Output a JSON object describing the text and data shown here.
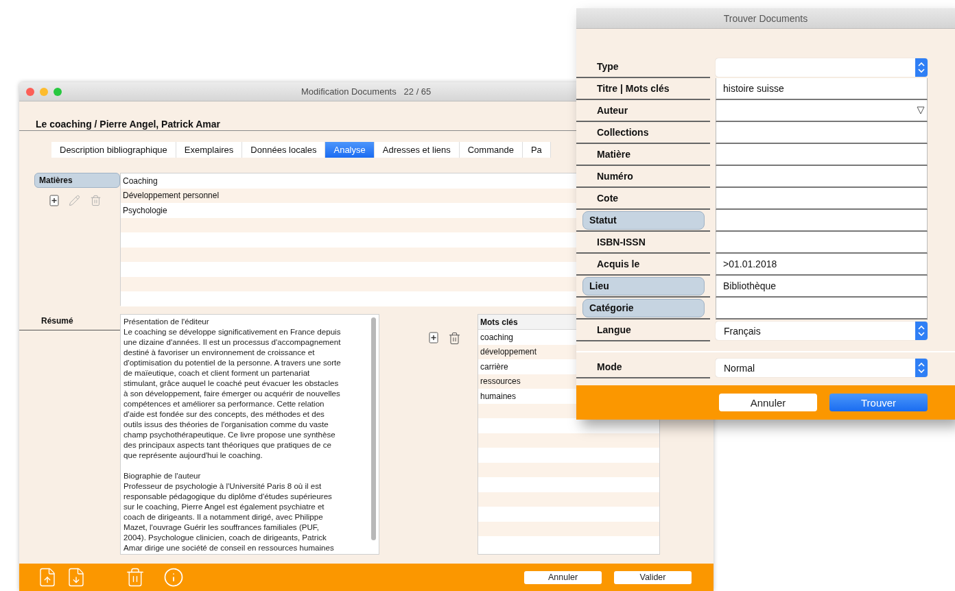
{
  "edit_window": {
    "title": "Modification Documents   22 / 65",
    "record_title": "Le coaching / Pierre Angel, Patrick Amar",
    "tabs": [
      {
        "label": "Description bibliographique",
        "selected": false
      },
      {
        "label": "Exemplaires",
        "selected": false
      },
      {
        "label": "Données locales",
        "selected": false
      },
      {
        "label": "Analyse",
        "selected": true
      },
      {
        "label": "Adresses et liens",
        "selected": false
      },
      {
        "label": "Commande",
        "selected": false
      },
      {
        "label": "Pa",
        "selected": false
      }
    ],
    "subjects": {
      "label": "Matières",
      "items": [
        "Coaching",
        "Développement personnel",
        "Psychologie"
      ]
    },
    "summary": {
      "label": "Résumé",
      "paragraphs": [
        [
          "Présentation de l'éditeur",
          "Le coaching se développe significativement en France depuis",
          "une dizaine d'années. Il est un processus d'accompagnement",
          "destiné à favoriser un environnement de croissance et",
          "d'optimisation du potentiel de la personne. A travers une sorte",
          "de maïeutique, coach et client forment un partenariat",
          "stimulant, grâce auquel le coaché peut évacuer les obstacles",
          "à son développement, faire émerger ou acquérir de nouvelles",
          "compétences et améliorer sa performance. Cette relation",
          "d'aide est fondée sur des concepts, des méthodes et des",
          "outils issus des théories de l'organisation comme du vaste",
          "champ psychothérapeutique. Ce livre propose une synthèse",
          "des principaux aspects tant théoriques que pratiques de ce",
          "que représente aujourd'hui le coaching."
        ],
        [
          "Biographie de l'auteur",
          "Professeur de psychologie à l'Université Paris 8 où il est",
          "responsable pédagogique du diplôme d'études supérieures",
          "sur le coaching, Pierre Angel est également psychiatre et",
          "coach de dirigeants. Il a notamment dirigé, avec Philippe",
          "Mazet, l'ouvrage Guérir les souffrances familiales (PUF,",
          "2004). Psychologue clinicien, coach de dirigeants, Patrick",
          "Amar dirige une société de conseil en ressources humaines"
        ]
      ]
    },
    "keywords": {
      "header": "Mots clés",
      "items": [
        "coaching",
        "développement",
        "carrière",
        "ressources",
        "humaines"
      ]
    },
    "buttons": [
      "Annuler",
      "Valider"
    ]
  },
  "find_dialog": {
    "title": "Trouver Documents",
    "fields": [
      {
        "label": "Type",
        "label_button": false,
        "kind": "select"
      },
      {
        "label": "Titre | Mots clés",
        "label_button": false,
        "kind": "text",
        "value": "histoire suisse"
      },
      {
        "label": "Auteur",
        "label_button": false,
        "kind": "combo"
      },
      {
        "label": "Collections",
        "label_button": false,
        "kind": "text"
      },
      {
        "label": "Matière",
        "label_button": false,
        "kind": "text"
      },
      {
        "label": "Numéro",
        "label_button": false,
        "kind": "text"
      },
      {
        "label": "Cote",
        "label_button": false,
        "kind": "text"
      },
      {
        "label": "Statut",
        "label_button": true,
        "kind": "text"
      },
      {
        "label": "ISBN-ISSN",
        "label_button": false,
        "kind": "text"
      },
      {
        "label": "Acquis le",
        "label_button": false,
        "kind": "text",
        "value": ">01.01.2018"
      },
      {
        "label": "Lieu",
        "label_button": true,
        "kind": "text",
        "value": "Bibliothèque"
      },
      {
        "label": "Catégorie",
        "label_button": true,
        "kind": "text"
      },
      {
        "label": "Langue",
        "label_button": false,
        "kind": "select",
        "value": "Français"
      }
    ],
    "mode": {
      "label": "Mode",
      "value": "Normal"
    },
    "buttons": [
      {
        "label": "Annuler",
        "kind": "secondary"
      },
      {
        "label": "Trouver",
        "kind": "primary"
      }
    ]
  }
}
